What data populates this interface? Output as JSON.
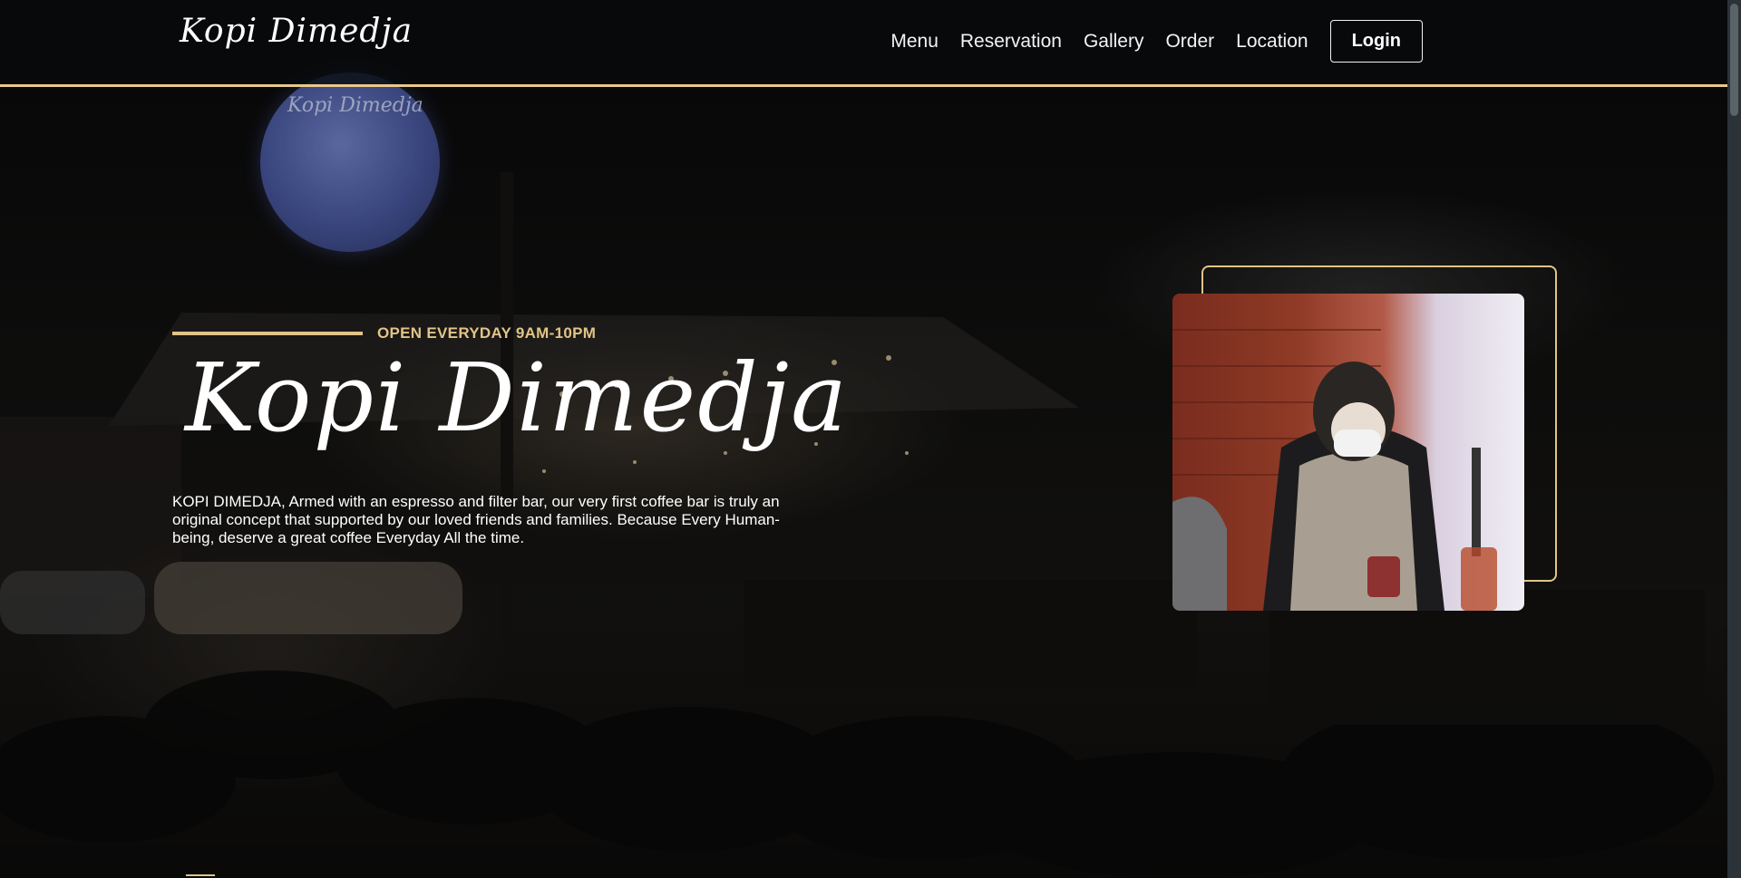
{
  "brand": {
    "logo_text": "Kopi Dimedja",
    "sign_text": "Kopi Dimedja"
  },
  "nav": {
    "items": [
      "Menu",
      "Reservation",
      "Gallery",
      "Order",
      "Location"
    ],
    "login_label": "Login"
  },
  "hero": {
    "open_hours": "OPEN EVERYDAY 9AM-10PM",
    "title": "Kopi Dimedja",
    "description": "KOPI DIMEDJA, Armed with an espresso and filter bar, our very first coffee bar is truly an original concept that supported by our loved friends and families. Because Every Human-being, deserve a great coffee Everyday All the time."
  },
  "colors": {
    "accent": "#e2c487",
    "header_border": "#e9c98a",
    "text": "#ffffff"
  }
}
